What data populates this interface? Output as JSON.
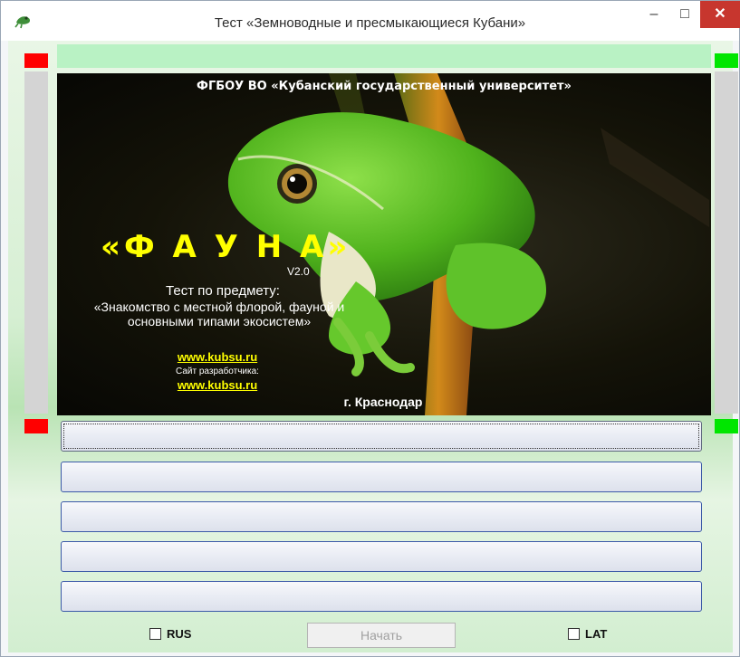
{
  "window": {
    "title": "Тест «Земноводные и пресмыкающиеся Кубани»",
    "controls": {
      "minimize": "–",
      "maximize": "□",
      "close": "✕"
    }
  },
  "splash": {
    "university": "ФГБОУ ВО «Кубанский государственный университет»",
    "brand": "«Ф А У Н А»",
    "version": "V2.0",
    "subject_line1": "Тест по предмету:",
    "subject_line2": "«Знакомство с местной флорой, фауной и основными типами экосистем»",
    "website": "www.kubsu.ru",
    "developer_label": "Сайт разработчика:",
    "developer_website": "www.kubsu.ru",
    "city": "г. Краснодар",
    "image": "tree-frog-photo"
  },
  "answers": [
    "",
    "",
    "",
    "",
    ""
  ],
  "footer": {
    "rus_label": "RUS",
    "rus_checked": false,
    "start_label": "Начать",
    "start_enabled": false,
    "lat_label": "LAT",
    "lat_checked": false
  },
  "colors": {
    "indicator_left": "#ff0000",
    "indicator_right": "#00e600",
    "top_strip": "#b9f2c4",
    "brand_text": "#ffff00"
  }
}
